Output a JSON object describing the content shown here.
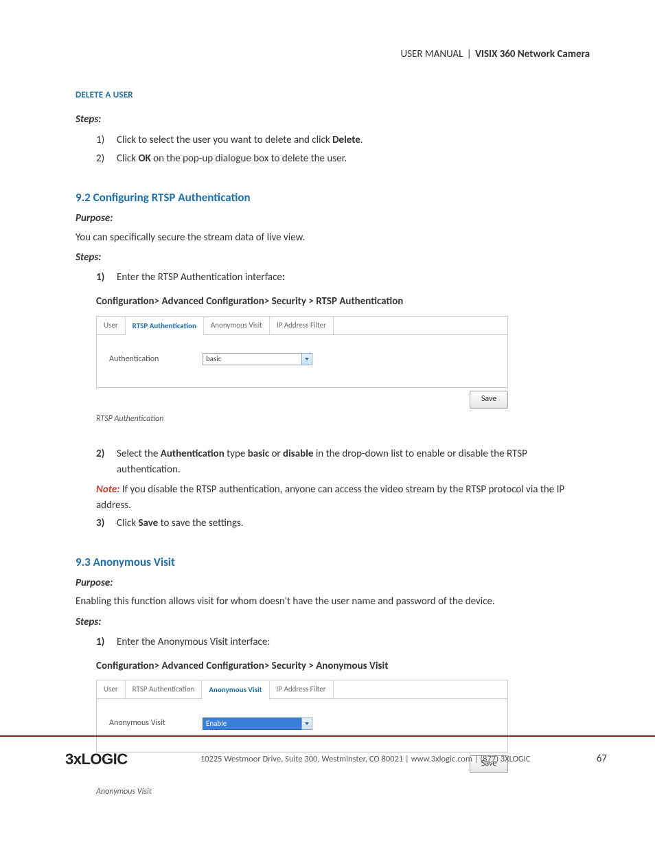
{
  "header": {
    "left": "USER MANUAL",
    "pipe": "|",
    "right": "VISIX 360 Network Camera"
  },
  "delete_user": {
    "title": "DELETE A USER",
    "steps_label": "Steps:",
    "steps": [
      {
        "n": "1)",
        "pre": "Click to select the user you want to delete and click ",
        "bold": "Delete",
        "post": "."
      },
      {
        "n": "2)",
        "pre": "Click ",
        "bold": "OK",
        "post": " on the pop-up dialogue box to delete the user."
      }
    ]
  },
  "s92": {
    "title": "9.2 Configuring RTSP Authentication",
    "purpose_label": "Purpose:",
    "purpose_text": "You can specifically secure the stream data of live view.",
    "steps_label": "Steps:",
    "step1": {
      "n": "1)",
      "pre": "Enter the RTSP Authentication interface",
      "bold_colon": ":"
    },
    "path": "Configuration> Advanced Configuration> Security > RTSP Authentication",
    "tabs": [
      "User",
      "RTSP Authentication",
      "Anonymous Visit",
      "IP Address Filter"
    ],
    "active_tab": 1,
    "field_label": "Authentication",
    "field_value": "basic",
    "save": "Save",
    "caption": "RTSP Authentication",
    "step2": {
      "n": "2)",
      "t1": "Select the ",
      "b1": "Authentication",
      "t2": " type ",
      "b2": "basic",
      "t3": " or ",
      "b3": "disable",
      "t4": " in the drop-down list to enable or disable the RTSP authentication."
    },
    "note": {
      "label": "Note:",
      "text": " If you disable the RTSP authentication, anyone can access the video stream by the RTSP protocol via the IP address."
    },
    "step3": {
      "n": "3)",
      "t1": "Click ",
      "b1": "Save",
      "t2": " to save the settings."
    }
  },
  "s93": {
    "title": "9.3 Anonymous Visit",
    "purpose_label": "Purpose:",
    "purpose_text": "Enabling this function allows visit for whom doesn't have the user name and password of the device.",
    "steps_label": "Steps:",
    "step1": {
      "n": "1)",
      "text": "Enter the Anonymous Visit interface:"
    },
    "path": "Configuration> Advanced Configuration> Security > Anonymous Visit",
    "tabs": [
      "User",
      "RTSP Authentication",
      "Anonymous Visit",
      "IP Address Filter"
    ],
    "active_tab": 2,
    "field_label": "Anonymous Visit",
    "field_value": "Enable",
    "save": "Save",
    "caption": "Anonymous Visit"
  },
  "footer": {
    "logo": "3xLOGIC",
    "text": "10225 Westmoor Drive, Suite 300, Westminster, CO 80021 | www.3xlogic.com | (877) 3XLOGIC",
    "page": "67"
  }
}
